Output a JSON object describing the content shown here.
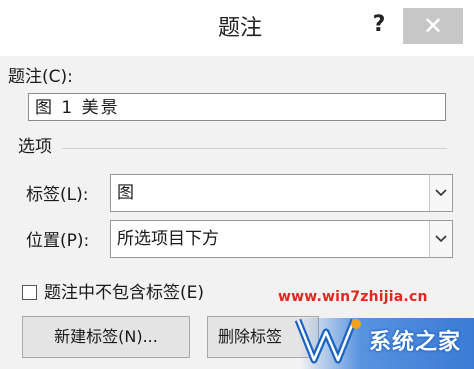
{
  "window": {
    "title": "题注",
    "help_label": "?",
    "close_label": "✕"
  },
  "caption": {
    "label": "题注(C):",
    "value": "图 1 美景"
  },
  "options": {
    "group_label": "选项",
    "label_field": {
      "label": "标签(L):",
      "value": "图"
    },
    "position_field": {
      "label": "位置(P):",
      "value": "所选项目下方"
    }
  },
  "exclude_label": {
    "label": "题注中不包含标签(E)",
    "checked": false
  },
  "buttons": {
    "new_label": "新建标签(N)...",
    "delete_label": "删除标签"
  },
  "watermark": {
    "url": "www.win7zhijia.cn",
    "text": "系统之家"
  }
}
